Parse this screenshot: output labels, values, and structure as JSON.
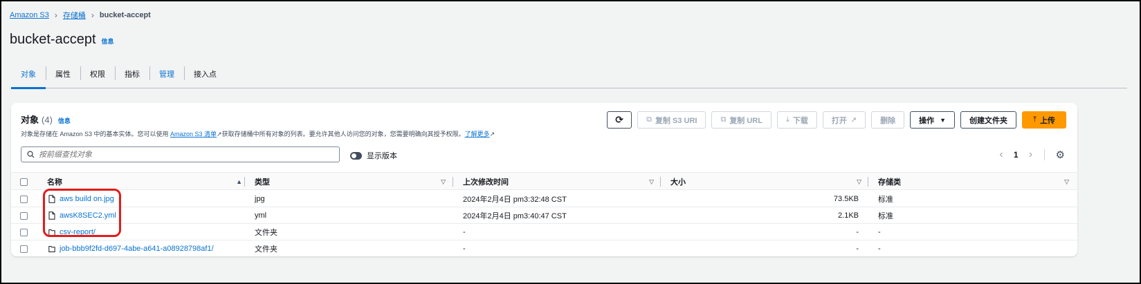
{
  "breadcrumb": {
    "root": "Amazon S3",
    "buckets": "存储桶",
    "current": "bucket-accept"
  },
  "page": {
    "title": "bucket-accept",
    "info": "信息"
  },
  "tabs": [
    "对象",
    "属性",
    "权限",
    "指标",
    "管理",
    "接入点"
  ],
  "panel": {
    "title": "对象",
    "count": "(4)",
    "info": "信息",
    "desc_before": "对象是存储在 Amazon S3 中的基本实体。您可以使用 ",
    "desc_link": "Amazon S3 清单",
    "desc_middle": "获取存储桶中所有对象的列表。要允许其他人访问您的对象，您需要明确向其授予权限。",
    "desc_learn": "了解更多"
  },
  "toolbar": {
    "copy_uri": "复制 S3 URI",
    "copy_url": "复制 URL",
    "download": "下载",
    "open": "打开",
    "delete": "删除",
    "actions": "操作",
    "create_folder": "创建文件夹",
    "upload": "上传"
  },
  "search": {
    "placeholder": "按前缀查找对象"
  },
  "toggle": {
    "label": "显示版本"
  },
  "pager": {
    "page": "1"
  },
  "table": {
    "headers": {
      "name": "名称",
      "type": "类型",
      "modified": "上次修改时间",
      "size": "大小",
      "storage": "存储类"
    },
    "rows": [
      {
        "name": "aws build on.jpg",
        "type": "jpg",
        "modified": "2024年2月4日 pm3:32:48 CST",
        "size": "73.5KB",
        "storage": "标准",
        "icon": "file"
      },
      {
        "name": "awsK8SEC2.yml",
        "type": "yml",
        "modified": "2024年2月4日 pm3:40:47 CST",
        "size": "2.1KB",
        "storage": "标准",
        "icon": "file"
      },
      {
        "name": "csv-report/",
        "type": "文件夹",
        "modified": "-",
        "size": "-",
        "storage": "-",
        "icon": "folder"
      },
      {
        "name": "job-bbb9f2fd-d697-4abe-a641-a08928798af1/",
        "type": "文件夹",
        "modified": "-",
        "size": "-",
        "storage": "-",
        "icon": "folder"
      }
    ]
  },
  "colors": {
    "link": "#0972d3",
    "primary": "#ff9900",
    "highlight": "#e41a1a"
  }
}
